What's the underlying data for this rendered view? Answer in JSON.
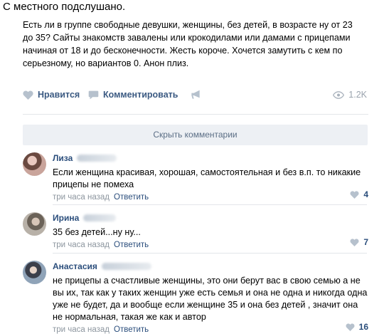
{
  "caption": "С местного подслушано.",
  "post": {
    "text": "Есть ли в группе свободные девушки, женщины, без детей, в возрасте ну от 23 до 35? Сайты знакомств завалены или крокодилами или дамами с прицепами начиная от 18 и до бесконечности. Жесть короче. Хочется замутить с кем по серьезному, но вариантов 0. Анон плиз.",
    "like_label": "Нравится",
    "comment_label": "Комментировать",
    "views": "1.2K"
  },
  "hide_comments_label": "Скрыть комментарии",
  "comments": [
    {
      "name": "Лиза",
      "text": "Если женщина красивая, хорошая, самостоятельная и без в.п. то никакие прицепы не помеха",
      "time": "три часа назад",
      "reply": "Ответить",
      "likes": "4"
    },
    {
      "name": "Ирина",
      "text": "35 без детей...ну ну...",
      "time": "три часа назад",
      "reply": "Ответить",
      "likes": "7"
    },
    {
      "name": "Анастасия",
      "text": "не прицепы а счастливые женщины, это они берут вас в свою семью а не вы их, так как у таких женщин уже есть семья и она не одна и никогда одна уже не будет, да и вообще если женщине 35 и она без детей , значит она не нормальная, такая же как и автор",
      "time": "три часа назад",
      "reply": "Ответить",
      "likes": "16"
    }
  ],
  "colors": {
    "link": "#2b4e7c",
    "muted": "#8d969f",
    "button_bg": "#edf0f4"
  }
}
